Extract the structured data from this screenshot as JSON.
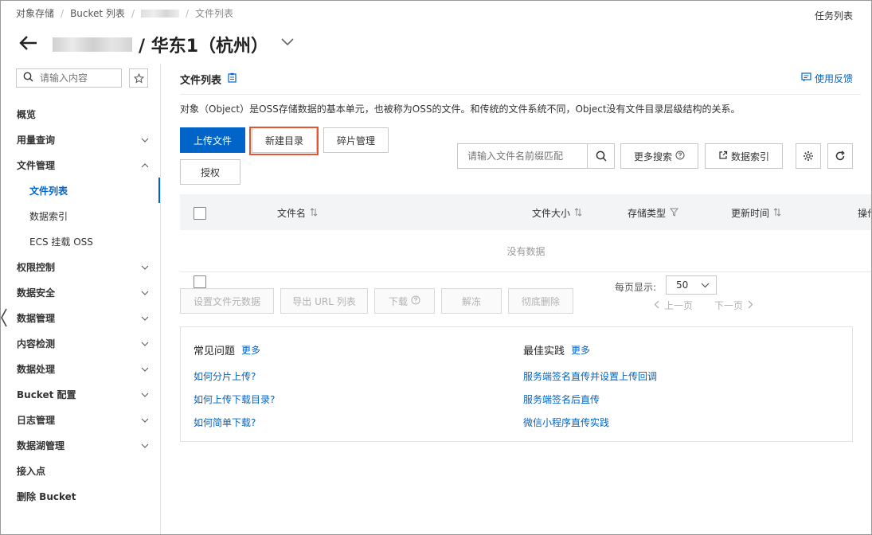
{
  "breadcrumb": {
    "items": [
      "对象存储",
      "Bucket 列表",
      "文件列表"
    ]
  },
  "header": {
    "region": "/ 华东1（杭州）",
    "task_list": "任务列表"
  },
  "sidebar": {
    "search_placeholder": "请输入内容",
    "items": [
      {
        "label": "概览"
      },
      {
        "label": "用量查询"
      },
      {
        "label": "文件管理"
      },
      {
        "label": "文件列表"
      },
      {
        "label": "数据索引"
      },
      {
        "label": "ECS 挂载 OSS"
      },
      {
        "label": "权限控制"
      },
      {
        "label": "数据安全"
      },
      {
        "label": "数据管理"
      },
      {
        "label": "内容检测"
      },
      {
        "label": "数据处理"
      },
      {
        "label": "Bucket 配置"
      },
      {
        "label": "日志管理"
      },
      {
        "label": "数据湖管理"
      },
      {
        "label": "接入点"
      },
      {
        "label": "删除 Bucket"
      }
    ]
  },
  "main": {
    "title": "文件列表",
    "feedback": "使用反馈",
    "description": "对象（Object）是OSS存储数据的基本单元，也被称为OSS的文件。和传统的文件系统不同，Object没有文件目录层级结构的关系。",
    "buttons": {
      "upload": "上传文件",
      "new_dir": "新建目录",
      "fragments": "碎片管理",
      "authorize": "授权",
      "more_search": "更多搜索",
      "data_index": "数据索引"
    },
    "search_placeholder": "请输入文件名前缀匹配",
    "table": {
      "columns": [
        "文件名",
        "文件大小",
        "存储类型",
        "更新时间",
        "操作"
      ],
      "empty": "没有数据"
    },
    "batch": {
      "set_meta": "设置文件元数据",
      "export_url": "导出 URL 列表",
      "download": "下载",
      "unfreeze": "解冻",
      "delete": "彻底删除"
    },
    "pagination": {
      "label": "每页显示:",
      "size": "50",
      "prev": "上一页",
      "next": "下一页"
    },
    "faq": {
      "title": "常见问题",
      "more": "更多",
      "links": [
        "如何分片上传?",
        "如何上传下载目录?",
        "如何简单下载?"
      ]
    },
    "best": {
      "title": "最佳实践",
      "more": "更多",
      "links": [
        "服务端签名直传并设置上传回调",
        "服务端签名后直传",
        "微信小程序直传实践"
      ]
    }
  },
  "colors": {
    "primary": "#0064c8",
    "highlight": "#e8542f"
  }
}
